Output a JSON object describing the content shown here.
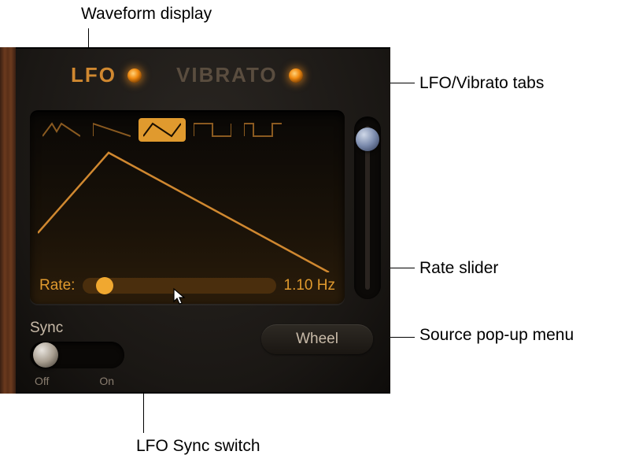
{
  "callouts": {
    "waveform_display": "Waveform display",
    "tabs": "LFO/Vibrato tabs",
    "rate_slider": "Rate slider",
    "source_menu": "Source pop-up menu",
    "sync_switch": "LFO Sync switch"
  },
  "tabs": {
    "lfo": "LFO",
    "vibrato": "VIBRATO",
    "active": "lfo"
  },
  "waveforms": {
    "options": [
      "triangle-notch",
      "saw-down",
      "triangle",
      "square",
      "pulse"
    ],
    "selected": 2
  },
  "rate": {
    "label": "Rate:",
    "value": "1.10 Hz",
    "position": 0.12
  },
  "depth_slider": {
    "position": 0.0
  },
  "sync": {
    "label": "Sync",
    "off": "Off",
    "on": "On",
    "state": "off"
  },
  "source": {
    "value": "Wheel"
  }
}
